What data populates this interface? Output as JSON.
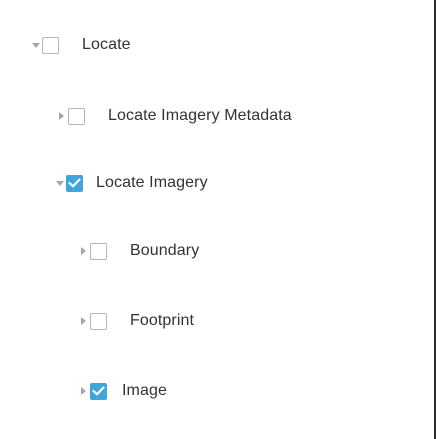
{
  "layers": [
    {
      "label": "Locate",
      "expanded": true,
      "checked": false
    },
    {
      "label": "Locate Imagery Metadata",
      "expanded": false,
      "checked": false
    },
    {
      "label": "Locate Imagery",
      "expanded": true,
      "checked": true
    },
    {
      "label": "Boundary",
      "expanded": false,
      "checked": false
    },
    {
      "label": "Footprint",
      "expanded": false,
      "checked": false
    },
    {
      "label": "Image",
      "expanded": false,
      "checked": true
    }
  ],
  "icons": {
    "expanded": "caret-down-icon",
    "collapsed": "caret-right-icon",
    "check": "checkmark-icon"
  },
  "colors": {
    "check_fill": "#3ea6da",
    "caret": "#a6a6a6",
    "text": "#323232"
  }
}
